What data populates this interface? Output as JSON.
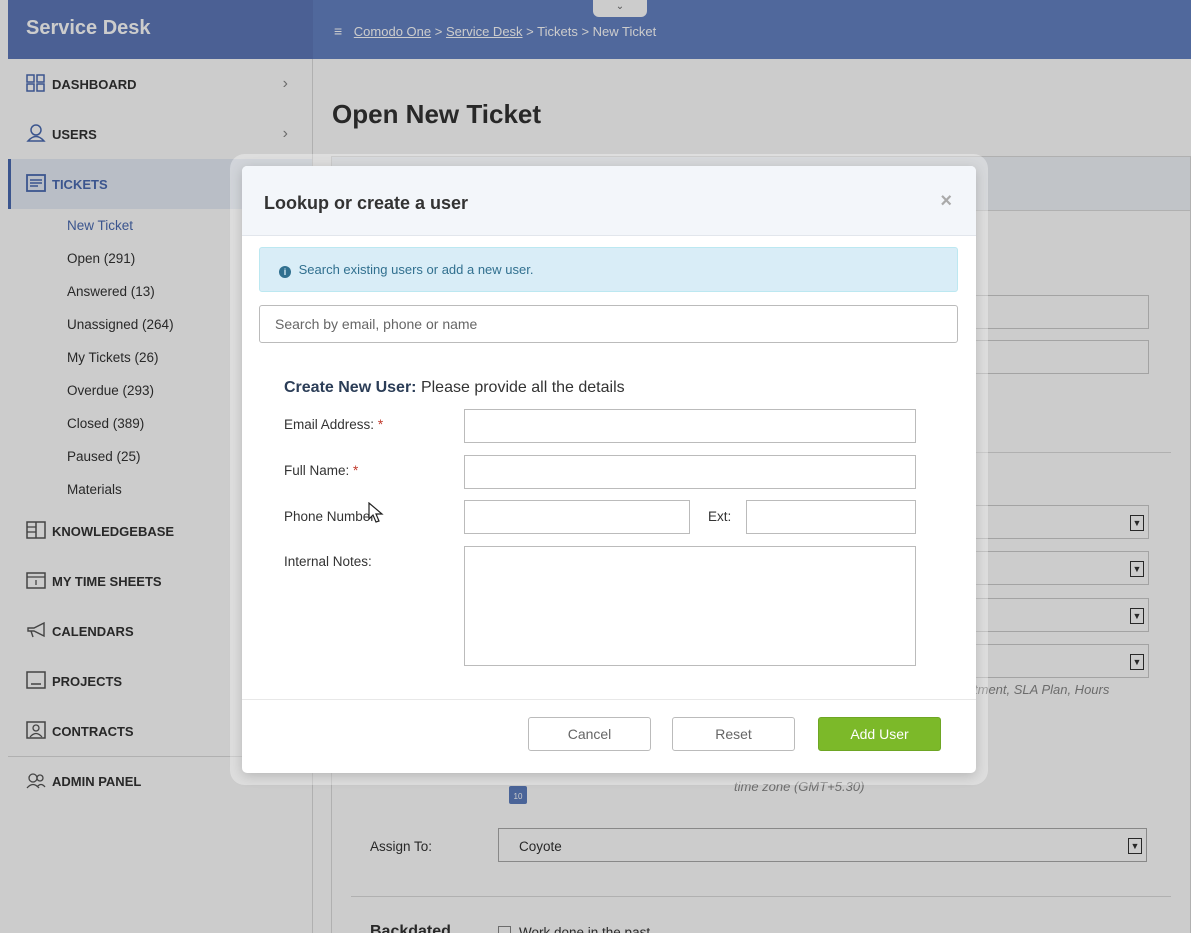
{
  "app": {
    "title": "Service Desk"
  },
  "breadcrumb": {
    "home": "Comodo One",
    "sep1": ">",
    "service_desk": "Service Desk",
    "tickets": "> Tickets",
    "current": "> New Ticket"
  },
  "collapse_glyph": "⌄",
  "sidebar": {
    "items": [
      {
        "label": "DASHBOARD",
        "icon": "dashboard-grid-icon",
        "chevron": "›"
      },
      {
        "label": "USERS",
        "icon": "user-icon",
        "chevron": "›"
      },
      {
        "label": "TICKETS",
        "icon": "ticket-icon"
      },
      {
        "label": "KNOWLEDGEBASE",
        "icon": "knowledgebase-icon"
      },
      {
        "label": "MY TIME SHEETS",
        "icon": "calendar-icon"
      },
      {
        "label": "CALENDARS",
        "icon": "megaphone-icon"
      },
      {
        "label": "PROJECTS",
        "icon": "projects-icon"
      },
      {
        "label": "CONTRACTS",
        "icon": "contracts-icon"
      },
      {
        "label": "ADMIN PANEL",
        "icon": "admin-users-icon"
      }
    ],
    "ticket_sub": [
      "New Ticket",
      "Open (291)",
      "Answered (13)",
      "Unassigned (264)",
      "My Tickets (26)",
      "Overdue (293)",
      "Closed (389)",
      "Paused (25)",
      "Materials"
    ]
  },
  "main": {
    "title": "Open New Ticket",
    "hint": "tment, SLA Plan, Hours",
    "timezone": "time zone (GMT+5.30)",
    "calendar_day": "10",
    "assign_label": "Assign To:",
    "assign_value": "Coyote",
    "backdated_label": "Backdated",
    "work_done_label": "Work done in the past"
  },
  "modal": {
    "title": "Lookup or create a user",
    "close": "×",
    "info_text": "Search existing users or add a new user.",
    "search_placeholder": "Search by email, phone or name",
    "create_title": "Create New User:",
    "create_sub": "Please provide all the details",
    "email_label": "Email Address:",
    "name_label": "Full Name:",
    "phone_label": "Phone Number:",
    "ext_label": "Ext:",
    "notes_label": "Internal Notes:",
    "required_mark": "*",
    "cancel": "Cancel",
    "reset": "Reset",
    "add_user": "Add User"
  }
}
